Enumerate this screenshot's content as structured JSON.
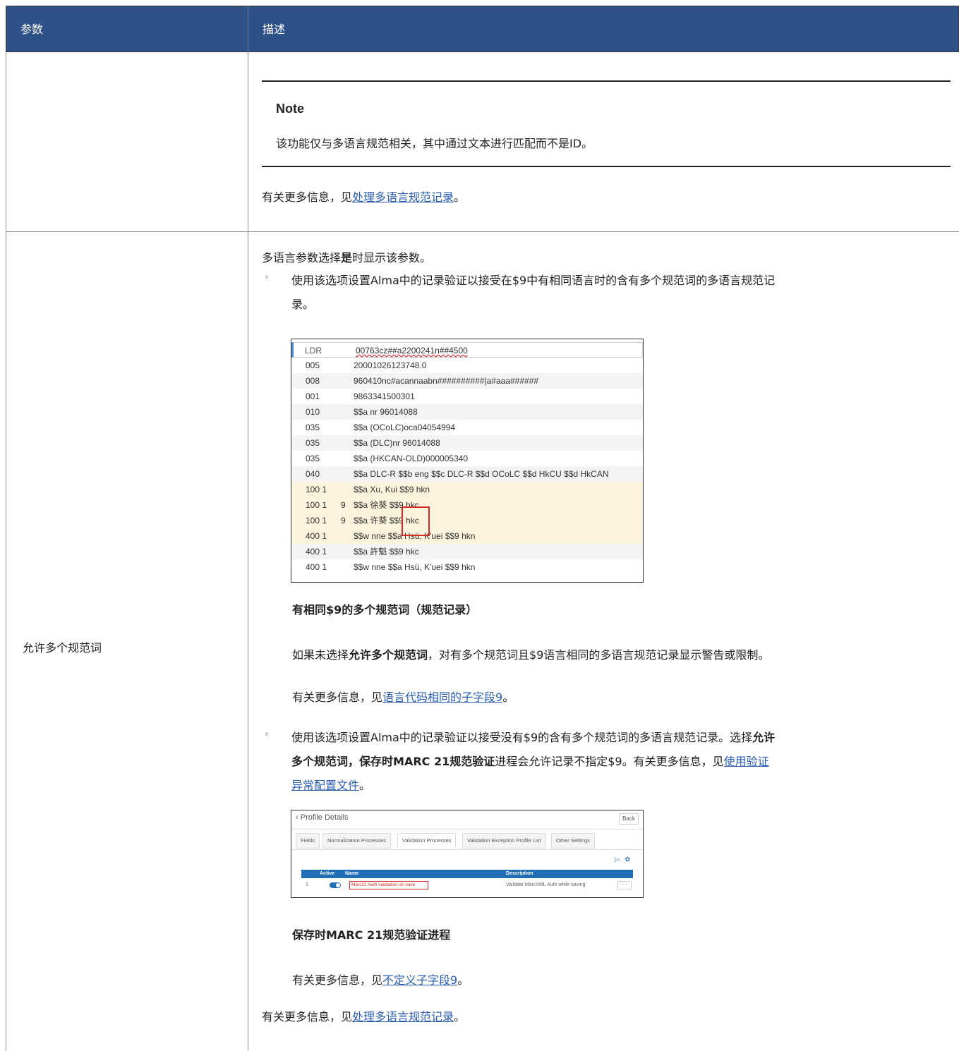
{
  "header": {
    "param": "参数",
    "desc": "描述"
  },
  "row1": {
    "note_title": "Note",
    "note_text": "该功能仅与多语言规范相关，其中通过文本进行匹配而不是ID。",
    "more_prefix": "有关更多信息，见",
    "more_link": "处理多语言规范记录",
    "more_suffix": "。"
  },
  "row2": {
    "param": "允许多个规范词",
    "intro_a": "多语言参数选择",
    "intro_b": "是",
    "intro_c": "时显示该参数。",
    "bullet_char": "◦",
    "b1_line1": "使用该选项设置Alma中的记录验证以接受在$9中有相同语言时的含有多个规范词的多语言规范记",
    "b1_line2": "录。",
    "caption1": "有相同$9的多个规范词（规范记录）",
    "p_warn_a": "如果未选择",
    "p_warn_b": "允许多个规范词",
    "p_warn_c": "，对有多个规范词且$9语言相同的多语言规范记录显示警告或限制。",
    "more1_prefix": "有关更多信息，见",
    "more1_link": "语言代码相同的子字段9",
    "more1_suffix": "。",
    "b2_l1_a": "使用该选项设置Alma中的记录验证以接受没有$9的含有多个规范词的多语言规范记录。选择",
    "b2_l1_b": "允许",
    "b2_l2_a": "多个规范词",
    "b2_l2_b": "，保存时",
    "b2_l2_c": "MARC 21规范验证",
    "b2_l2_d": "进程会允许记录不指定$9。有关更多信息，见",
    "b2_l2_link": "使用验证",
    "b2_l3_link": "异常配置文件",
    "b2_l3_suffix": "。",
    "caption2": "保存时MARC 21规范验证进程",
    "more2_prefix": "有关更多信息，见",
    "more2_link": "不定义子字段9",
    "more2_suffix": "。",
    "more3_prefix": "有关更多信息，见",
    "more3_link": "处理多语言规范记录",
    "more3_suffix": "。"
  },
  "marc_record": {
    "rows": [
      {
        "tag": "LDR",
        "ind": "",
        "val": "00763cz##a2200241n##4500",
        "style": "ldr"
      },
      {
        "tag": "005",
        "ind": "",
        "val": "20001026123748.0",
        "style": "plain"
      },
      {
        "tag": "008",
        "ind": "",
        "val": "960410nc#acannaabn##########|a#aaa######",
        "style": "alt"
      },
      {
        "tag": "001",
        "ind": "",
        "val": "9863341500301",
        "style": "plain"
      },
      {
        "tag": "010",
        "ind": "",
        "val": "$$a nr 96014088",
        "style": "alt"
      },
      {
        "tag": "035",
        "ind": "",
        "val": "$$a (OCoLC)oca04054994",
        "style": "plain"
      },
      {
        "tag": "035",
        "ind": "",
        "val": "$$a (DLC)nr 96014088",
        "style": "alt"
      },
      {
        "tag": "035",
        "ind": "",
        "val": "$$a (HKCAN-OLD)000005340",
        "style": "plain"
      },
      {
        "tag": "040",
        "ind": "",
        "val": "$$a DLC-R $$b eng $$c DLC-R $$d OCoLC $$d HkCU $$d HkCAN",
        "style": "alt"
      },
      {
        "tag": "100 1",
        "ind": "",
        "val": "$$a Xu, Kui $$9 hkn",
        "style": "hl"
      },
      {
        "tag": "100 1",
        "ind": "9",
        "val": "$$a 徐葵 $$9 hkc",
        "style": "hl"
      },
      {
        "tag": "100 1",
        "ind": "9",
        "val": "$$a 许葵 $$9 hkc",
        "style": "hl"
      },
      {
        "tag": "400 1",
        "ind": "",
        "val": "$$w nne $$a Hsü, K'uei $$9 hkn",
        "style": "hl"
      },
      {
        "tag": "400 1",
        "ind": "",
        "val": "$$a 許魁 $$9 hkc",
        "style": "alt"
      },
      {
        "tag": "400 1",
        "ind": "",
        "val": "$$w nne $$a Hsü, K'uei $$9 hkn",
        "style": "plain"
      }
    ]
  },
  "profile_details": {
    "title": "Profile Details",
    "back": "Back",
    "tabs": [
      "Fields",
      "Normalization Processes",
      "Validation Processes",
      "Validation Exception Profile List",
      "Other Settings"
    ],
    "active_tab": "Validation Processes",
    "icons": [
      "export-icon",
      "gear-icon"
    ],
    "columns": {
      "active": "Active",
      "name": "Name",
      "description": "Description"
    },
    "row": {
      "index": "1",
      "name": "Marc21 Auth validation on save",
      "description": "Validate MarcXML Auth while saving",
      "actions": "···"
    }
  }
}
